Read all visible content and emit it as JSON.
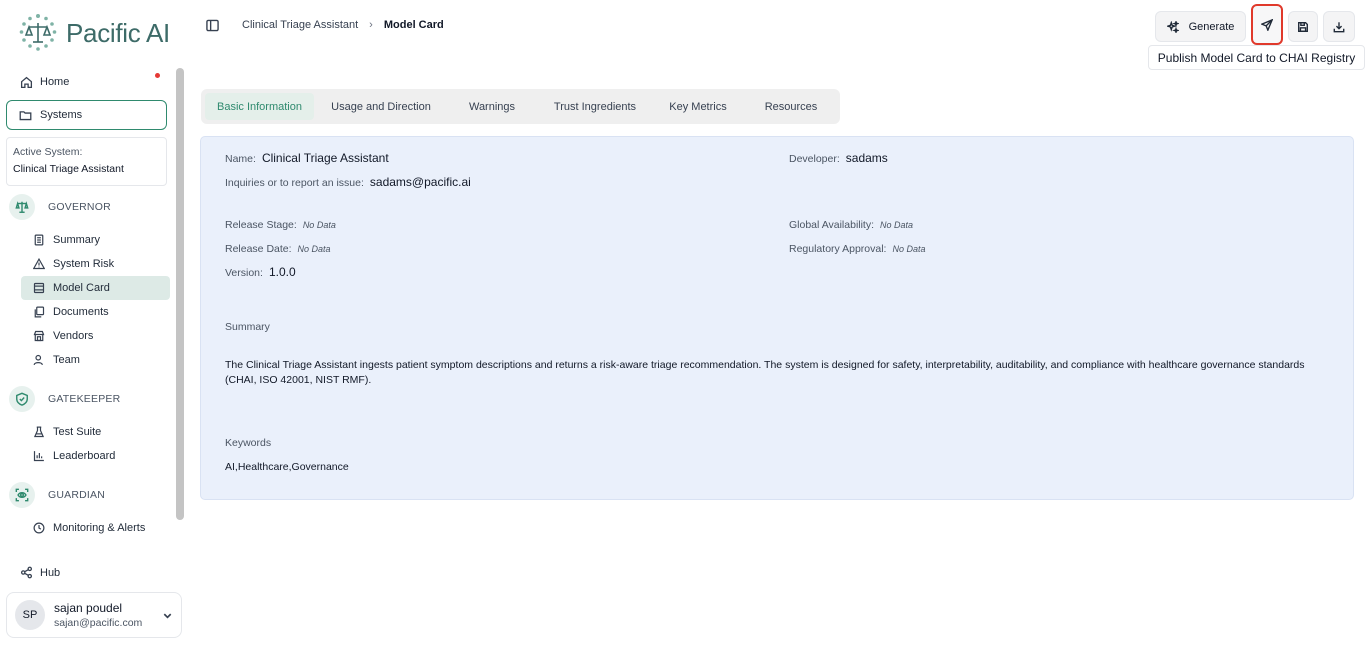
{
  "brand": {
    "name": "Pacific AI",
    "accent": "#2f8a6e",
    "logo_color": "#3d6b68"
  },
  "sidebar": {
    "home": {
      "label": "Home",
      "icon": "home-icon"
    },
    "systems": {
      "label": "Systems",
      "icon": "folder-icon"
    },
    "active_system": {
      "label": "Active System:",
      "value": "Clinical Triage Assistant"
    },
    "sections": [
      {
        "title": "GOVERNOR",
        "icon": "scales-icon",
        "items": [
          {
            "label": "Summary",
            "icon": "document-icon"
          },
          {
            "label": "System Risk",
            "icon": "warning-icon"
          },
          {
            "label": "Model Card",
            "icon": "card-icon",
            "active": true
          },
          {
            "label": "Documents",
            "icon": "files-icon"
          },
          {
            "label": "Vendors",
            "icon": "store-icon"
          },
          {
            "label": "Team",
            "icon": "user-icon"
          }
        ]
      },
      {
        "title": "GATEKEEPER",
        "icon": "shield-check-icon",
        "items": [
          {
            "label": "Test Suite",
            "icon": "flask-icon"
          },
          {
            "label": "Leaderboard",
            "icon": "bar-chart-icon"
          }
        ]
      },
      {
        "title": "GUARDIAN",
        "icon": "eye-scan-icon",
        "items": [
          {
            "label": "Monitoring & Alerts",
            "icon": "clock-icon"
          }
        ]
      }
    ],
    "hub": {
      "label": "Hub",
      "icon": "share-icon"
    },
    "user": {
      "initials": "SP",
      "name": "sajan poudel",
      "email": "sajan@pacific.com"
    }
  },
  "header": {
    "breadcrumb": {
      "parent": "Clinical Triage Assistant",
      "current": "Model Card"
    },
    "generate_label": "Generate",
    "tooltip": "Publish Model Card to CHAI Registry"
  },
  "tabs": [
    {
      "label": "Basic Information",
      "active": true
    },
    {
      "label": "Usage and Direction"
    },
    {
      "label": "Warnings"
    },
    {
      "label": "Trust Ingredients"
    },
    {
      "label": "Key Metrics"
    },
    {
      "label": "Resources"
    }
  ],
  "model_card": {
    "name_label": "Name:",
    "name": "Clinical Triage Assistant",
    "developer_label": "Developer:",
    "developer": "sadams",
    "inquiries_label": "Inquiries or to report an issue:",
    "inquiries": "sadams@pacific.ai",
    "release_stage_label": "Release Stage:",
    "release_stage": "No Data",
    "global_availability_label": "Global Availability:",
    "global_availability": "No Data",
    "release_date_label": "Release Date:",
    "release_date": "No Data",
    "regulatory_approval_label": "Regulatory Approval:",
    "regulatory_approval": "No Data",
    "version_label": "Version:",
    "version": "1.0.0",
    "summary_label": "Summary",
    "summary": "The Clinical Triage Assistant ingests patient symptom descriptions and returns a risk-aware triage recommendation. The system is designed for safety, interpretability, auditability, and compliance with healthcare governance standards (CHAI, ISO 42001, NIST RMF).",
    "keywords_label": "Keywords",
    "keywords": "AI,Healthcare,Governance"
  }
}
